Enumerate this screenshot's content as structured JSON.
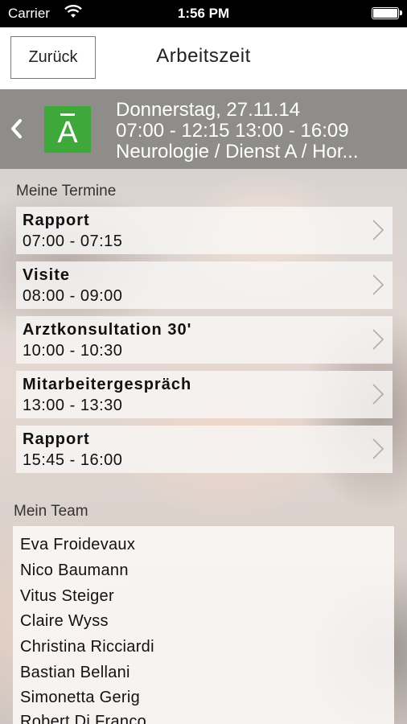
{
  "status_bar": {
    "carrier": "Carrier",
    "time": "1:56 PM"
  },
  "nav": {
    "back_label": "Zurück",
    "title": "Arbeitszeit"
  },
  "day": {
    "badge_letter": "A",
    "badge_color": "#3ea83b",
    "date": "Donnerstag, 27.11.14",
    "hours": "07:00 - 12:15 13:00 - 16:09",
    "unit": "Neurologie / Dienst A / Hor..."
  },
  "appointments_section": {
    "label": "Meine Termine",
    "items": [
      {
        "title": "Rapport",
        "time": "07:00 - 07:15"
      },
      {
        "title": "Visite",
        "time": "08:00 - 09:00"
      },
      {
        "title": "Arztkonsultation 30'",
        "time": "10:00 - 10:30"
      },
      {
        "title": "Mitarbeitergespräch",
        "time": "13:00 - 13:30"
      },
      {
        "title": "Rapport",
        "time": "15:45 - 16:00"
      }
    ]
  },
  "team_section": {
    "label": "Mein Team",
    "members": [
      "Eva Froidevaux",
      "Nico Baumann",
      "Vitus Steiger",
      "Claire Wyss",
      "Christina Ricciardi",
      "Bastian Bellani",
      "Simonetta Gerig",
      "Robert Di Franco"
    ]
  }
}
